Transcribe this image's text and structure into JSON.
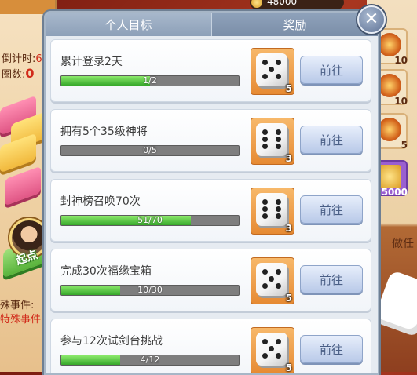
{
  "background": {
    "timer_label": "倒计时:",
    "rounds_label": "圈数:",
    "rounds_value": "0",
    "start_label": "起点",
    "event_label": "殊事件:",
    "event_value": "特殊事件",
    "coins": "48000",
    "right_rewards": [
      "10",
      "10",
      "5",
      "5000"
    ],
    "right_label": "做任"
  },
  "dialog": {
    "tabs": [
      {
        "label": "个人目标",
        "active": true
      },
      {
        "label": "奖励",
        "active": false
      }
    ],
    "close_icon": "close-x",
    "tasks": [
      {
        "title": "累计登录2天",
        "progress_text": "1/2",
        "progress": 0.5,
        "reward_icon": "dice-icon",
        "reward_count": "5",
        "button": "前往"
      },
      {
        "title": "拥有5个35级神将",
        "progress_text": "0/5",
        "progress": 0,
        "reward_icon": "dice-icon",
        "reward_count": "3",
        "button": "前往"
      },
      {
        "title": "封神榜召唤70次",
        "progress_text": "51/70",
        "progress": 0.7286,
        "reward_icon": "dice-icon",
        "reward_count": "3",
        "button": "前往"
      },
      {
        "title": "完成30次福缘宝箱",
        "progress_text": "10/30",
        "progress": 0.3333,
        "reward_icon": "dice-icon",
        "reward_count": "5",
        "button": "前往"
      },
      {
        "title": "参与12次试剑台挑战",
        "progress_text": "4/12",
        "progress": 0.3333,
        "reward_icon": "dice-icon",
        "reward_count": "5",
        "button": "前往"
      }
    ]
  },
  "colors": {
    "progress_fill": "#36a82a",
    "progress_track": "#7e7e7e",
    "reward_bg": "#e68a33",
    "button_text": "#4a5f86"
  }
}
